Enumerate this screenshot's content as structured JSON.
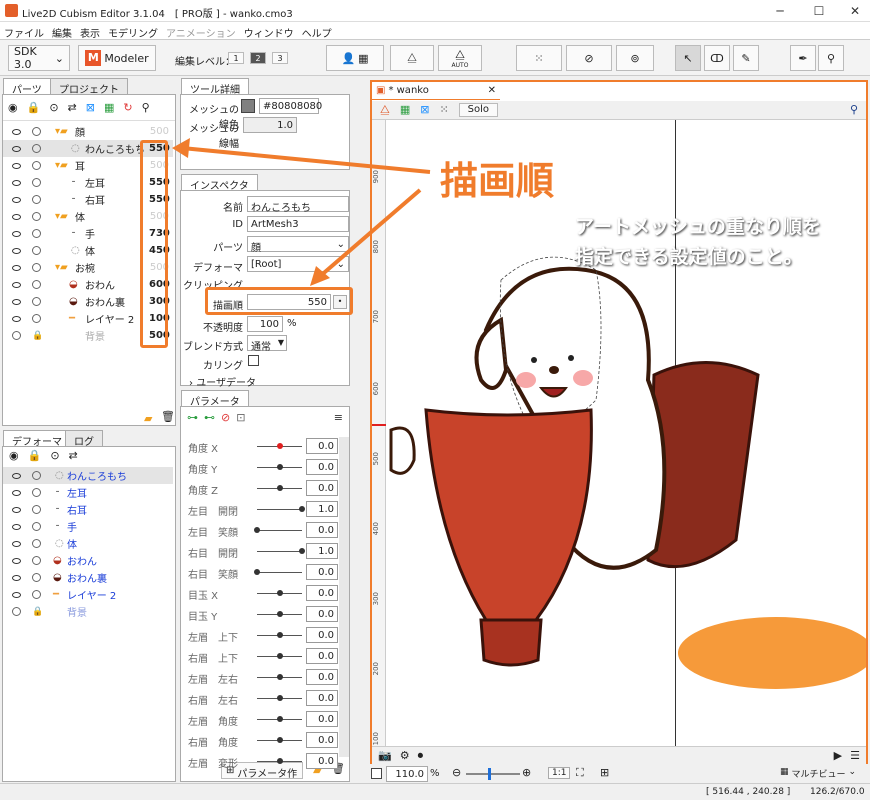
{
  "window": {
    "title": "Live2D Cubism Editor 3.1.04　[ PRO版 ] - wanko.cmo3"
  },
  "menu": [
    "ファイル",
    "編集",
    "表示",
    "モデリング",
    "アニメーション",
    "ウィンドウ",
    "ヘルプ"
  ],
  "toolbar": {
    "sdk": "SDK 3.0",
    "modeler": "Modeler",
    "edit_level_label": "編集レベル：",
    "levels": [
      "1",
      "2",
      "3"
    ],
    "auto": "AUTO"
  },
  "parts_panel": {
    "tabs": [
      "パーツ",
      "プロジェクト"
    ],
    "rows": [
      {
        "name": "顔",
        "order": "500",
        "dim": true
      },
      {
        "name": "わんころもち",
        "order": "550",
        "dim": false
      },
      {
        "name": "耳",
        "order": "500",
        "dim": true
      },
      {
        "name": "左耳",
        "order": "550",
        "dim": false
      },
      {
        "name": "右耳",
        "order": "550",
        "dim": false
      },
      {
        "name": "体",
        "order": "500",
        "dim": true
      },
      {
        "name": "手",
        "order": "730",
        "dim": false
      },
      {
        "name": "体",
        "order": "450",
        "dim": false
      },
      {
        "name": "お椀",
        "order": "500",
        "dim": true
      },
      {
        "name": "おわん",
        "order": "600",
        "dim": false
      },
      {
        "name": "おわん裏",
        "order": "300",
        "dim": false
      },
      {
        "name": "レイヤー 2",
        "order": "100",
        "dim": false
      },
      {
        "name": "背景",
        "order": "500",
        "dim": false
      }
    ]
  },
  "deformer_panel": {
    "tabs": [
      "デフォーマ",
      "ログ"
    ],
    "rows": [
      "わんころもち",
      "左耳",
      "右耳",
      "手",
      "体",
      "おわん",
      "おわん裏",
      "レイヤー 2",
      "背景"
    ]
  },
  "tool_detail": {
    "tab": "ツール詳細",
    "mesh_color_label": "メッシュの線色",
    "mesh_color_value": "#80808080",
    "mesh_width_label": "メッシュの線幅",
    "mesh_width_value": "1.0"
  },
  "inspector": {
    "tab": "インスペクタ",
    "name_label": "名前",
    "name_value": "わんころもち",
    "id_label": "ID",
    "id_value": "ArtMesh3",
    "parts_label": "パーツ",
    "parts_value": "顔",
    "deformer_label": "デフォーマ",
    "deformer_value": "[Root]",
    "clipping_label": "クリッピング",
    "draw_order_label": "描画順",
    "draw_order_value": "550",
    "opacity_label": "不透明度",
    "opacity_value": "100",
    "opacity_unit": "%",
    "blend_label": "ブレンド方式",
    "blend_value": "通常",
    "culling_label": "カリング",
    "userdata_label": "ユーザデータ"
  },
  "parameters": {
    "tab": "パラメータ",
    "create_button": "パラメータ作成",
    "rows": [
      {
        "name": "角度 X",
        "value": "0.0",
        "knob": 0.5
      },
      {
        "name": "角度 Y",
        "value": "0.0",
        "knob": 0.5
      },
      {
        "name": "角度 Z",
        "value": "0.0",
        "knob": 0.5
      },
      {
        "name": "左目　開閉",
        "value": "1.0",
        "knob": 1.0
      },
      {
        "name": "左目　笑顔",
        "value": "0.0",
        "knob": 0.0
      },
      {
        "name": "右目　開閉",
        "value": "1.0",
        "knob": 1.0
      },
      {
        "name": "右目　笑顔",
        "value": "0.0",
        "knob": 0.0
      },
      {
        "name": "目玉 X",
        "value": "0.0",
        "knob": 0.5
      },
      {
        "name": "目玉 Y",
        "value": "0.0",
        "knob": 0.5
      },
      {
        "name": "左眉　上下",
        "value": "0.0",
        "knob": 0.5
      },
      {
        "name": "右眉　上下",
        "value": "0.0",
        "knob": 0.5
      },
      {
        "name": "左眉　左右",
        "value": "0.0",
        "knob": 0.5
      },
      {
        "name": "右眉　左右",
        "value": "0.0",
        "knob": 0.5
      },
      {
        "name": "左眉　角度",
        "value": "0.0",
        "knob": 0.5
      },
      {
        "name": "右眉　角度",
        "value": "0.0",
        "knob": 0.5
      },
      {
        "name": "左眉　変形",
        "value": "0.0",
        "knob": 0.5
      }
    ]
  },
  "canvas": {
    "tab": "* wanko",
    "solo": "Solo",
    "ruler": [
      "900",
      "800",
      "700",
      "600",
      "500",
      "400",
      "300",
      "200",
      "100"
    ],
    "zoom": "110.0",
    "zoom_unit": "%",
    "ratio": "1:1",
    "multiview": "マルチビュー"
  },
  "annotation": {
    "title": "描画順",
    "text_line1": "アートメッシュの重なり順を",
    "text_line2": "指定できる設定値のこと。"
  },
  "status": {
    "coords": "[  516.44 ,  240.28 ]",
    "zoomratio": "126.2/670.0"
  },
  "colors": {
    "accent": "#f07c2c",
    "blue_text": "#1a3dd8"
  }
}
